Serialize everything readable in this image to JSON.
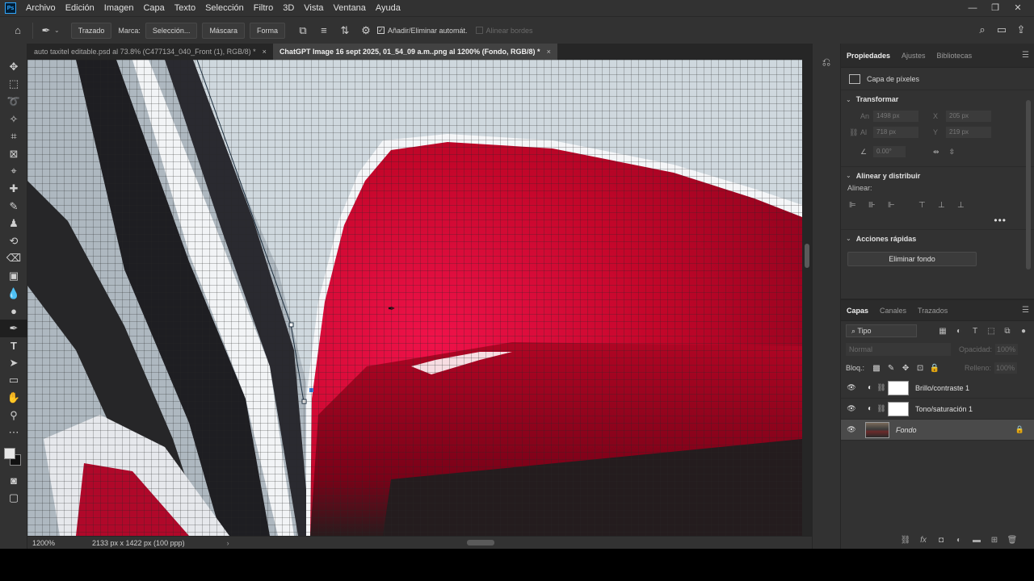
{
  "menubar": {
    "logo": "Ps",
    "items": [
      "Archivo",
      "Edición",
      "Imagen",
      "Capa",
      "Texto",
      "Selección",
      "Filtro",
      "3D",
      "Vista",
      "Ventana",
      "Ayuda"
    ]
  },
  "options": {
    "mode": "Trazado",
    "marca_label": "Marca:",
    "seleccion": "Selección...",
    "mascara": "Máscara",
    "forma": "Forma",
    "auto_add": "Añadir/Eliminar automát.",
    "align_edges": "Alinear bordes"
  },
  "tabs": [
    {
      "label": "auto taxitel editable.psd al 73.8% (C477134_040_Front (1), RGB/8) *",
      "close": "×"
    },
    {
      "label": "ChatGPT Image 16 sept 2025, 01_54_09 a.m..png al 1200% (Fondo, RGB/8) *",
      "close": "×"
    }
  ],
  "status": {
    "zoom": "1200%",
    "doc_size": "2133 px x 1422 px (100 ppp)",
    "arrow": "›"
  },
  "properties": {
    "tabs": [
      "Propiedades",
      "Ajustes",
      "Bibliotecas"
    ],
    "layer_type": "Capa de píxeles",
    "transform_title": "Transformar",
    "an_label": "An",
    "an_value": "1498 px",
    "x_label": "X",
    "x_value": "205 px",
    "al_label": "Al",
    "al_value": "718 px",
    "y_label": "Y",
    "y_value": "219 px",
    "angle_value": "0.00°",
    "align_title": "Alinear y distribuir",
    "align_label": "Alinear:",
    "more": "•••",
    "quick_title": "Acciones rápidas",
    "remove_bg": "Eliminar fondo"
  },
  "layers": {
    "tabs": [
      "Capas",
      "Canales",
      "Trazados"
    ],
    "filter": "Tipo",
    "blend": "Normal",
    "opacity_label": "Opacidad:",
    "opacity_value": "100%",
    "lock_label": "Bloq.:",
    "fill_label": "Relleno:",
    "fill_value": "100%",
    "items": [
      {
        "name": "Brillo/contraste 1"
      },
      {
        "name": "Tono/saturación 1"
      },
      {
        "name": "Fondo"
      }
    ]
  }
}
